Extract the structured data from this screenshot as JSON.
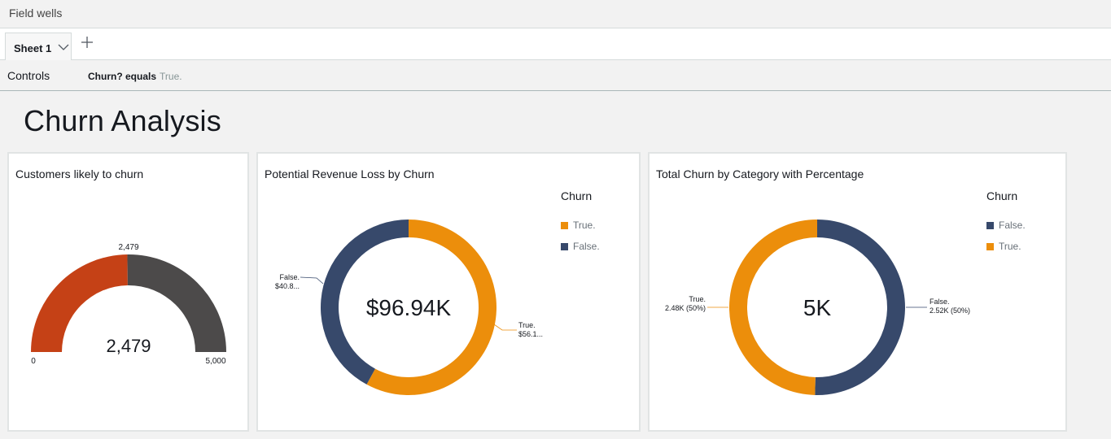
{
  "field_wells": {
    "label": "Field wells"
  },
  "sheets": {
    "tabs": [
      {
        "label": "Sheet 1"
      }
    ]
  },
  "controls": {
    "label": "Controls",
    "filter_field": "Churn? equals",
    "filter_value": "True."
  },
  "dashboard": {
    "title": "Churn Analysis"
  },
  "colors": {
    "orange": "#ec8e0b",
    "navy": "#37496b",
    "gauge_red": "#c54116",
    "gauge_gray": "#4c4a4a"
  },
  "visuals": {
    "gauge": {
      "title": "Customers likely to churn",
      "value_label": "2,479",
      "top_label": "2,479",
      "min_label": "0",
      "max_label": "5,000"
    },
    "revenue": {
      "title": "Potential Revenue Loss by Churn",
      "center_label": "$96.94K",
      "legend_title": "Churn",
      "legend": [
        {
          "label": "True.",
          "color": "#ec8e0b"
        },
        {
          "label": "False.",
          "color": "#37496b"
        }
      ],
      "callouts": [
        {
          "line1": "False.",
          "line2": "$40.8..."
        },
        {
          "line1": "True.",
          "line2": "$56.1..."
        }
      ]
    },
    "category": {
      "title": "Total Churn by Category with Percentage",
      "center_label": "5K",
      "legend_title": "Churn",
      "legend": [
        {
          "label": "False.",
          "color": "#37496b"
        },
        {
          "label": "True.",
          "color": "#ec8e0b"
        }
      ],
      "callouts": [
        {
          "line1": "True.",
          "line2": "2.48K (50%)"
        },
        {
          "line1": "False.",
          "line2": "2.52K (50%)"
        }
      ]
    }
  },
  "chart_data": [
    {
      "type": "gauge",
      "title": "Customers likely to churn",
      "value": 2479,
      "min": 0,
      "max": 5000
    },
    {
      "type": "pie",
      "title": "Potential Revenue Loss by Churn",
      "categories": [
        "True.",
        "False."
      ],
      "values": [
        56.14,
        40.8
      ],
      "unit": "$K",
      "total": "$96.94K"
    },
    {
      "type": "pie",
      "title": "Total Churn by Category with Percentage",
      "categories": [
        "False.",
        "True."
      ],
      "values": [
        2.52,
        2.48
      ],
      "unit": "K",
      "total": "5K"
    }
  ]
}
